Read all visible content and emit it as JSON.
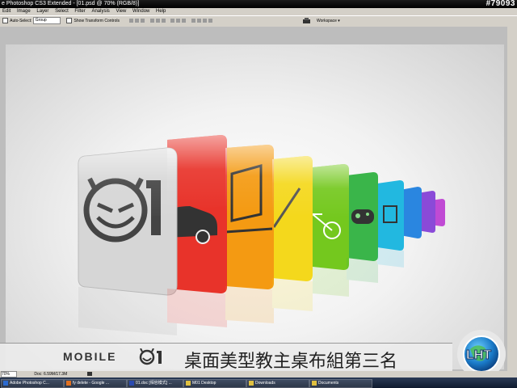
{
  "window": {
    "title": "e Photoshop CS3 Extended - [01.psd @ 70% (RGB/8)]",
    "watermark": "#79093"
  },
  "menu": [
    "Edit",
    "Image",
    "Layer",
    "Select",
    "Filter",
    "Analysis",
    "View",
    "Window",
    "Help"
  ],
  "options": {
    "auto_select_label": "Auto-Select:",
    "auto_select_value": "Group",
    "transform_label": "Show Transform Controls",
    "workspace_label": "Workspace ▾"
  },
  "banner": {
    "mobile_text": "MOBILE",
    "title_cn": "桌面美型教主桌布組第三名"
  },
  "status": {
    "zoom": "70%",
    "doc": "Doc: 6.59M/17.3M"
  },
  "taskbar": {
    "items": [
      "Adobe Photoshop C...",
      "fy delete - Google ...",
      "01.doc [相容模式] ...",
      "M01 Desktop",
      "Downloads",
      "Documents"
    ]
  },
  "colors": {
    "card_gray": "#d9d9d9",
    "card_red": "#e8302a",
    "card_orange": "#f39a12",
    "card_yellow": "#f5dc1c",
    "card_green": "#6ec41c",
    "card_green2": "#2fb24a",
    "card_cyan": "#22b2d8",
    "card_blue": "#2a7fd6",
    "card_purple": "#9a4ad4",
    "card_violet": "#b04ad0"
  }
}
